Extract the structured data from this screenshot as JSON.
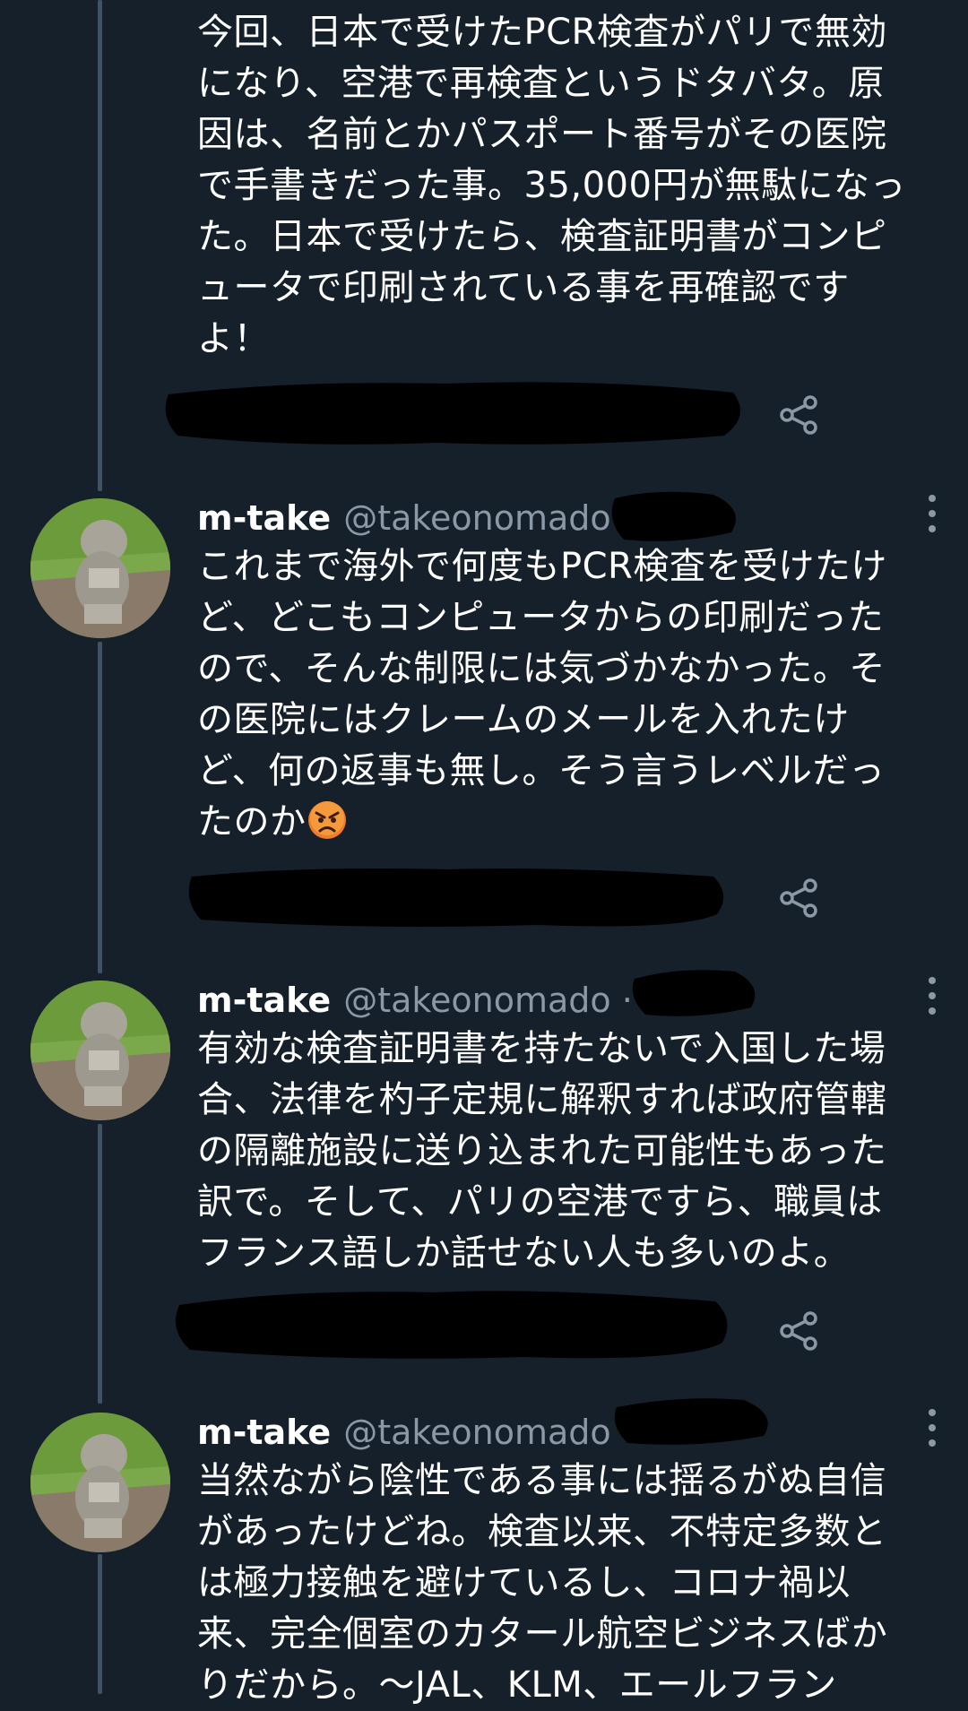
{
  "tweets": [
    {
      "text": "今回、日本で受けたPCR検査がパリで無効\nになり、空港で再検査というドタバタ。原\n因は、名前とかパスポート番号がその医院\nで手書きだった事。35,000円が無駄になっ\nた。日本で受けたら、検査証明書がコンピ\nュータで印刷されている事を再確認です\nよ！"
    },
    {
      "name": "m-take",
      "handle": "@takeonomado",
      "text": "これまで海外で何度もPCR検査を受けたけ\nど、どこもコンピュータからの印刷だった\nので、そんな制限には気づかなかった。そ\nの医院にはクレームのメールを入れたけ\nど、何の返事も無し。そう言うレベルだっ\nたのか",
      "emoji": "angry-face-emoji"
    },
    {
      "name": "m-take",
      "handle": "@takeonomado",
      "separator": "·",
      "text": "有効な検査証明書を持たないで入国した場\n合、法律を杓子定規に解釈すれば政府管轄\nの隔離施設に送り込まれた可能性もあった\n訳で。そして、パリの空港ですら、職員は\nフランス語しか話せない人も多いのよ。"
    },
    {
      "name": "m-take",
      "handle": "@takeonomado",
      "text": "当然ながら陰性である事には揺るがぬ自信\nがあったけどね。検査以来、不特定多数と\nは極力接触を避けているし、コロナ禍以\n来、完全個室のカタール航空ビジネスばか\nりだから。〜JAL、KLM、エールフラン"
    }
  ],
  "icons": {
    "share": "share-icon",
    "more": "more-options-icon",
    "avatar": "avatar-statue-photo"
  },
  "colors": {
    "background": "#15202b",
    "text": "#ffffff",
    "secondary": "#8b98a5",
    "thread_line": "#3d5466"
  }
}
